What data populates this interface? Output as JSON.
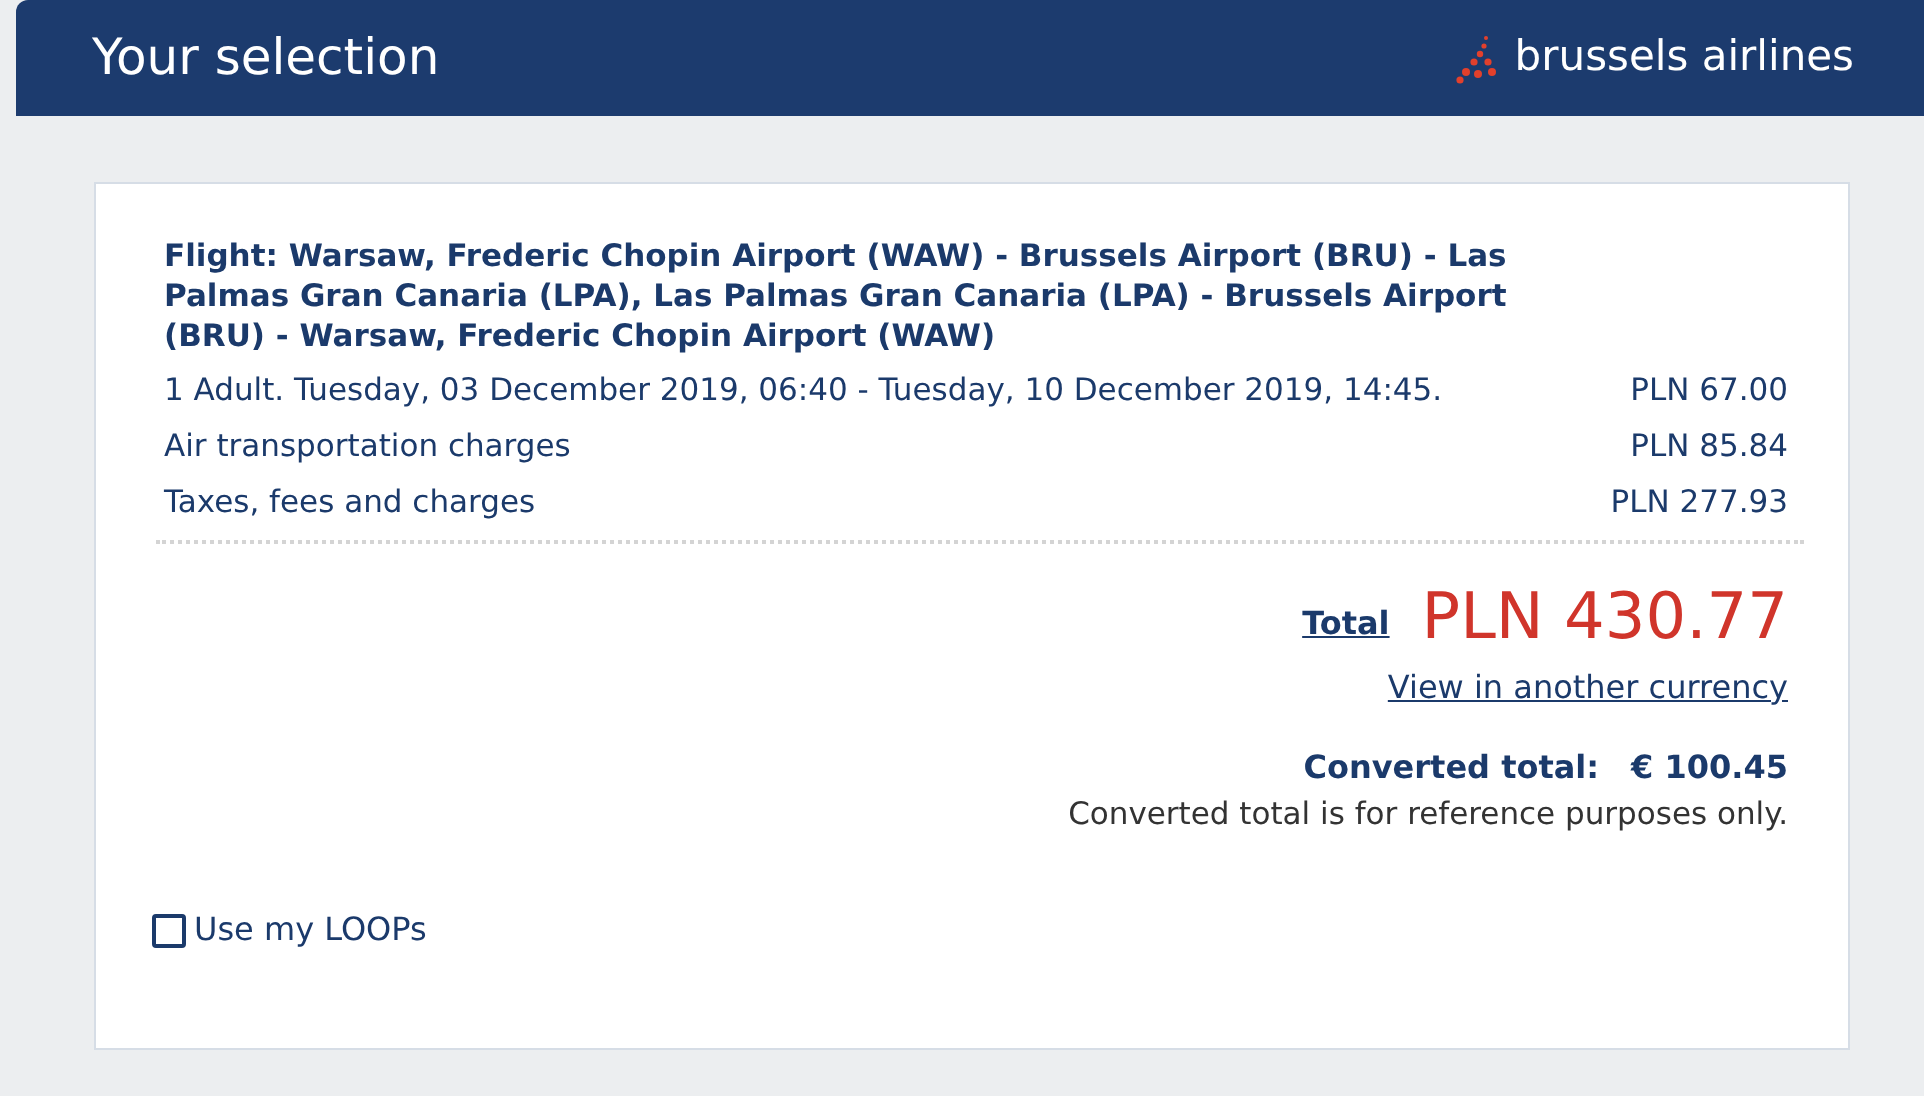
{
  "header": {
    "title": "Your selection",
    "brand": "brussels airlines"
  },
  "flight": "Flight: Warsaw, Frederic Chopin Airport (WAW) - Brussels Airport (BRU) - Las Palmas Gran Canaria (LPA), Las Palmas Gran Canaria (LPA) - Brussels Airport (BRU) - Warsaw, Frederic Chopin Airport (WAW)",
  "lines": [
    {
      "label": "1 Adult. Tuesday, 03 December 2019, 06:40 - Tuesday, 10 December 2019, 14:45.",
      "amount": "PLN 67.00"
    },
    {
      "label": "Air transportation charges",
      "amount": "PLN 85.84"
    },
    {
      "label": "Taxes, fees and charges",
      "amount": "PLN 277.93"
    }
  ],
  "total": {
    "label": "Total",
    "amount": "PLN 430.77"
  },
  "currency_link": "View in another currency",
  "converted": {
    "label": "Converted total:",
    "amount": "€ 100.45",
    "note": "Converted total is for reference purposes only."
  },
  "loops": {
    "label": "Use my LOOPs",
    "checked": false
  }
}
